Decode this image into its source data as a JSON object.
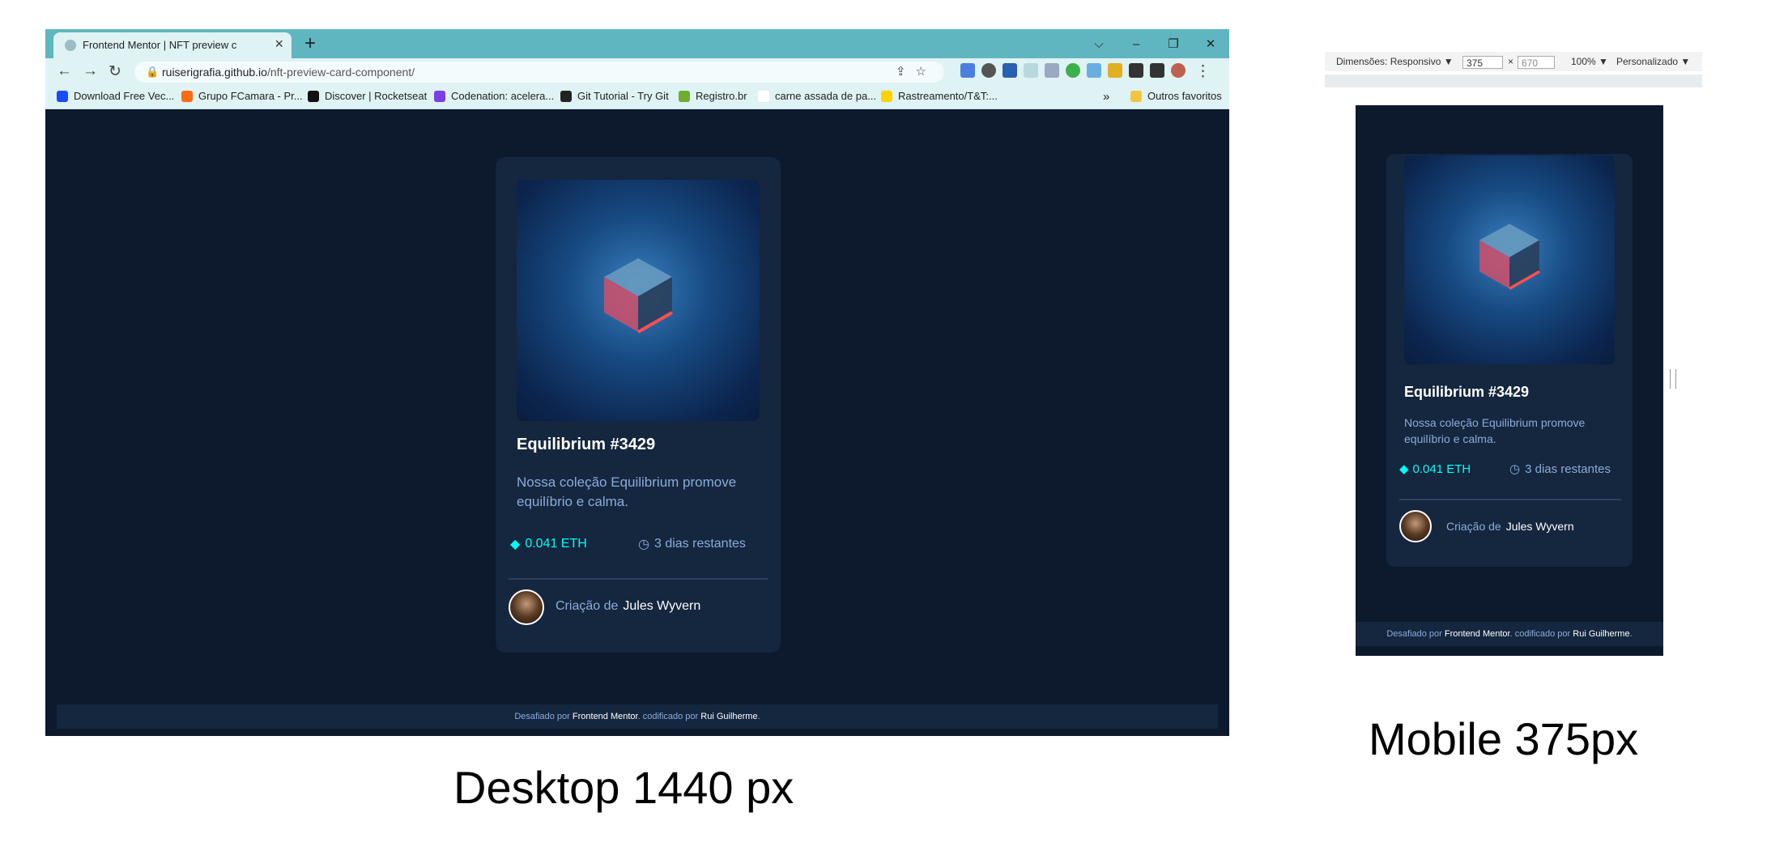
{
  "colors": {
    "page_bg": "#0d192c",
    "card_bg": "#15263f",
    "accent_cyan": "#00fff8",
    "soft_blue": "#8bacd9",
    "chrome_accent": "#5fb6c0"
  },
  "desktop": {
    "tab": {
      "title": "Frontend Mentor | NFT preview c",
      "close_icon": "close-icon",
      "new_tab": "+"
    },
    "window_controls": {
      "dropdown": "⌵",
      "minimize": "–",
      "restore": "❐",
      "close": "✕"
    },
    "address": {
      "domain": "ruiserigrafia.github.io",
      "path": "/nft-preview-card-component/"
    },
    "bookmarks": [
      {
        "label": "Download Free Vec...",
        "color": "#1a4cff"
      },
      {
        "label": "Grupo FCamara - Pr...",
        "color": "#ff6a13"
      },
      {
        "label": "Discover | Rocketseat",
        "color": "#121214"
      },
      {
        "label": "Codenation: acelera...",
        "color": "#7b3fe4"
      },
      {
        "label": "Git Tutorial - Try Git",
        "color": "#222222"
      },
      {
        "label": "Registro.br",
        "color": "#6cae2f"
      },
      {
        "label": "carne assada de pa...",
        "color": "#ffffff"
      },
      {
        "label": "Rastreamento/T&T:...",
        "color": "#ffd200"
      }
    ],
    "bookmarks_overflow": "»",
    "other_favorites": "Outros favoritos",
    "card": {
      "title": "Equilibrium #3429",
      "description": "Nossa coleção Equilibrium promove equilíbrio e calma.",
      "price": "0.041 ETH",
      "time_left": "3 dias restantes",
      "creation_prefix": "Criação de",
      "creator_name": "Jules Wyvern"
    },
    "footer": {
      "prefix": "Desafiado por",
      "challenge": "Frontend Mentor",
      "middle": ". codificado por",
      "author": "Rui Guilherme",
      "suffix": "."
    }
  },
  "desktop_caption": "Desktop 1440 px",
  "mobile": {
    "devtools": {
      "dimensions_label": "Dimensões: Responsivo ▼",
      "width": "375",
      "times": "×",
      "height": "670",
      "zoom": "100% ▼",
      "throttle": "Personalizado ▼"
    },
    "card": {
      "title": "Equilibrium #3429",
      "description": "Nossa coleção Equilibrium promove equilíbrio e calma.",
      "price": "0.041 ETH",
      "time_left": "3 dias restantes",
      "creation_prefix": "Criação de",
      "creator_name": "Jules Wyvern"
    },
    "footer": {
      "prefix": "Desafiado por",
      "challenge": "Frontend Mentor",
      "middle": ". codificado por",
      "author": "Rui Guilherme",
      "suffix": "."
    }
  },
  "mobile_caption": "Mobile 375px"
}
